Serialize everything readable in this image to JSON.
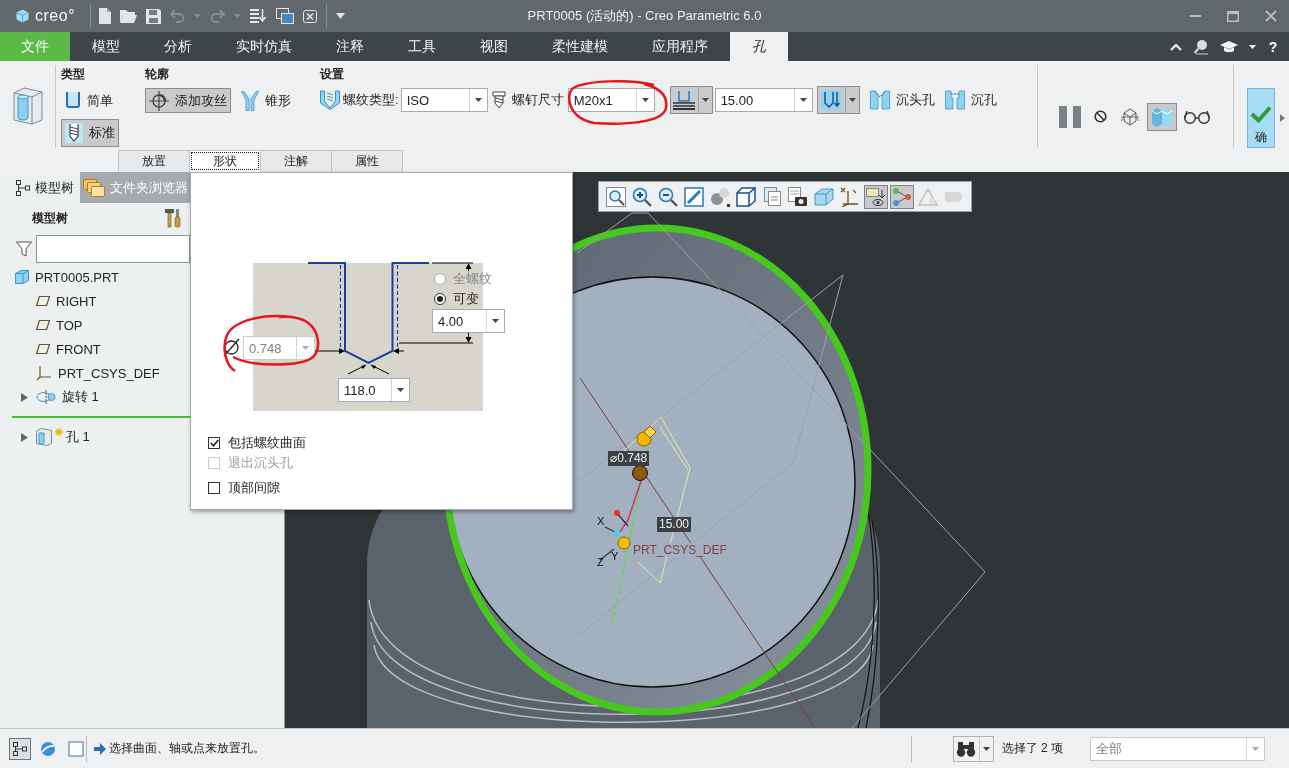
{
  "window": {
    "logo": "creo°",
    "title": "PRT0005 (活动的) - Creo Parametric 6.0",
    "quick_access": [
      {
        "kind": "new",
        "disabled": false
      },
      {
        "kind": "open",
        "disabled": false
      },
      {
        "kind": "save",
        "disabled": false
      },
      {
        "kind": "undo",
        "disabled": true
      },
      {
        "kind": "redo",
        "disabled": true
      },
      {
        "kind": "regenerate",
        "disabled": false
      },
      {
        "kind": "windows",
        "disabled": false
      },
      {
        "kind": "close",
        "disabled": false
      }
    ]
  },
  "menu": {
    "tabs": [
      {
        "label": "文件",
        "kind": "file",
        "selected": false
      },
      {
        "label": "模型",
        "kind": "tab",
        "selected": false
      },
      {
        "label": "分析",
        "kind": "tab",
        "selected": false
      },
      {
        "label": "实时仿真",
        "kind": "tab",
        "selected": false
      },
      {
        "label": "注释",
        "kind": "tab",
        "selected": false
      },
      {
        "label": "工具",
        "kind": "tab",
        "selected": false
      },
      {
        "label": "视图",
        "kind": "tab",
        "selected": false
      },
      {
        "label": "柔性建模",
        "kind": "tab",
        "selected": false
      },
      {
        "label": "应用程序",
        "kind": "tab",
        "selected": false
      },
      {
        "label": "孔",
        "kind": "tab",
        "selected": true
      }
    ],
    "help": "?"
  },
  "ribbon": {
    "type_group": {
      "title": "类型",
      "buttons": [
        {
          "label": "简单",
          "kind": "simple",
          "selected": false
        },
        {
          "label": "标准",
          "kind": "standard",
          "selected": true
        }
      ]
    },
    "profile_group": {
      "title": "轮廓",
      "buttons": [
        {
          "label": "添加攻丝",
          "kind": "tap",
          "selected": true
        },
        {
          "label": "锥形",
          "kind": "taper",
          "selected": false
        }
      ]
    },
    "settings_group": {
      "title": "设置",
      "thread_type": {
        "label": "螺纹类型:",
        "value": "ISO"
      },
      "screw_size": {
        "label": "螺钉尺寸",
        "value": "M20x1",
        "highlighted": true
      },
      "depth_type": {
        "selected": true
      },
      "depth": {
        "value": "15.00"
      },
      "depth_option": {
        "selected": true
      },
      "toggles": [
        {
          "label": "沉头孔",
          "kind": "countersink",
          "selected": false
        },
        {
          "label": "沉孔",
          "kind": "counterbore",
          "selected": false
        }
      ]
    },
    "preview_controls": [
      {
        "kind": "pause",
        "selected": false
      },
      {
        "kind": "stop",
        "selected": false
      },
      {
        "kind": "wireframe",
        "selected": false
      },
      {
        "kind": "preview",
        "selected": true
      },
      {
        "kind": "glasses",
        "selected": false
      }
    ],
    "confirm": {
      "label": "确"
    },
    "panel_tabs": [
      {
        "label": "放置",
        "selected": false
      },
      {
        "label": "形状",
        "selected": true
      },
      {
        "label": "注解",
        "selected": false
      },
      {
        "label": "属性",
        "selected": false
      }
    ]
  },
  "model_tree": {
    "tabs": [
      {
        "label": "模型树",
        "selected": true
      },
      {
        "label": "文件夹浏览器",
        "selected": false
      }
    ],
    "title": "模型树",
    "items": [
      {
        "label": "PRT0005.PRT",
        "kind": "part",
        "children": [
          {
            "label": "RIGHT",
            "kind": "plane"
          },
          {
            "label": "TOP",
            "kind": "plane"
          },
          {
            "label": "FRONT",
            "kind": "plane"
          },
          {
            "label": "PRT_CSYS_DEF",
            "kind": "csys"
          },
          {
            "label": "旋转 1",
            "kind": "revolve",
            "expanded": false
          },
          {
            "kind": "insert"
          },
          {
            "label": "孔 1",
            "kind": "hole",
            "expanded": false,
            "editing": true
          }
        ]
      }
    ]
  },
  "shape_panel": {
    "diameter": {
      "value": "0.748",
      "disabled": true,
      "highlighted": true
    },
    "angle": {
      "value": "118.0"
    },
    "thread_options": [
      {
        "label": "全螺纹",
        "selected": false,
        "disabled": true
      },
      {
        "label": "可变",
        "selected": true,
        "disabled": false
      }
    ],
    "thread_depth": {
      "value": "4.00"
    },
    "checkboxes": [
      {
        "label": "包括螺纹曲面",
        "checked": true,
        "disabled": false
      },
      {
        "label": "退出沉头孔",
        "checked": false,
        "disabled": true
      },
      {
        "label": "顶部间隙",
        "checked": false,
        "disabled": false
      }
    ]
  },
  "graphics": {
    "view_toolbar": [
      {
        "kind": "refit",
        "selected": false,
        "disabled": false
      },
      {
        "kind": "zoomin",
        "selected": false,
        "disabled": false
      },
      {
        "kind": "zoomout",
        "selected": false,
        "disabled": false
      },
      {
        "kind": "repaint",
        "selected": false,
        "disabled": false
      },
      {
        "kind": "style",
        "selected": false,
        "disabled": false
      },
      {
        "kind": "orientation",
        "selected": false,
        "disabled": false
      },
      {
        "kind": "views",
        "selected": false,
        "disabled": false
      },
      {
        "kind": "screenshot",
        "selected": false,
        "disabled": false
      },
      {
        "kind": "section",
        "selected": false,
        "disabled": false
      },
      {
        "kind": "datums",
        "selected": false,
        "disabled": false
      },
      {
        "kind": "annotations",
        "selected": true,
        "disabled": false
      },
      {
        "kind": "spin",
        "selected": true,
        "disabled": false
      },
      {
        "kind": "triangle",
        "selected": false,
        "disabled": true
      },
      {
        "kind": "appearance",
        "selected": false,
        "disabled": true
      }
    ],
    "labels": {
      "diameter": "⌀0.748",
      "depth": "15.00",
      "csys": "PRT_CSYS_DEF",
      "axis_x": "X",
      "axis_y": "Y",
      "axis_z": "Z"
    }
  },
  "status_bar": {
    "tools": [
      {
        "kind": "tree",
        "selected": true
      },
      {
        "kind": "browser",
        "selected": false
      },
      {
        "kind": "graphics",
        "selected": false
      }
    ],
    "message": "选择曲面、轴或点来放置孔。",
    "selection": "选择了 2 项",
    "filter": {
      "value": "全部",
      "disabled": true
    }
  }
}
